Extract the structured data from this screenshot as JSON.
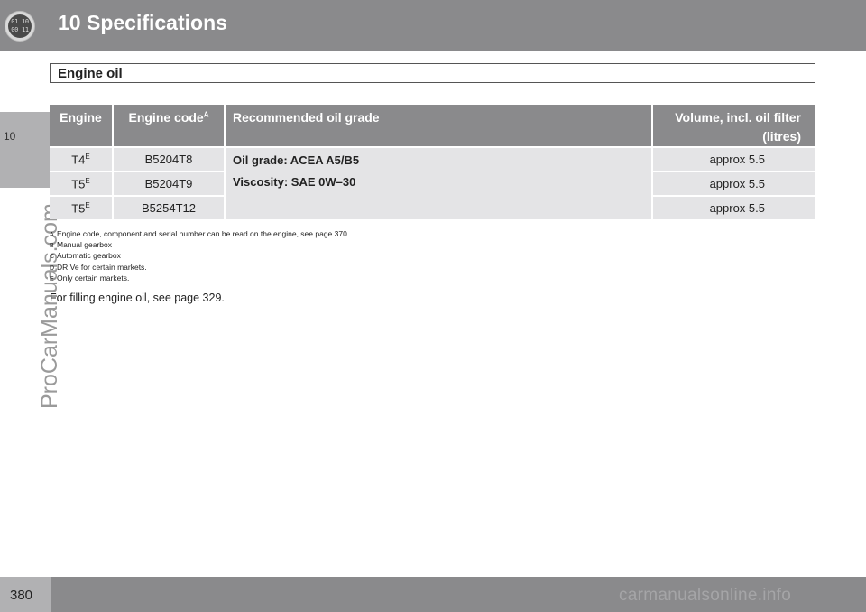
{
  "header": {
    "chapter_icon_text": "01 10\n00 11",
    "chapter_title": "10 Specifications"
  },
  "side_tab": {
    "number": "10",
    "watermark": "ProCarManuals.com"
  },
  "section": {
    "title": "Engine oil"
  },
  "table": {
    "headers": {
      "engine": "Engine",
      "engine_code": "Engine code",
      "engine_code_sup": "A",
      "grade": "Recommended oil grade",
      "volume_line1": "Volume, incl. oil filter",
      "volume_line2": "(litres)"
    },
    "grade_text": {
      "oil_grade": "Oil grade: ACEA A5/B5",
      "viscosity": "Viscosity: SAE 0W–30"
    },
    "rows": [
      {
        "engine": "T4",
        "engine_sup": "E",
        "code": "B5204T8",
        "volume": "approx 5.5"
      },
      {
        "engine": "T5",
        "engine_sup": "E",
        "code": "B5204T9",
        "volume": "approx 5.5"
      },
      {
        "engine": "T5",
        "engine_sup": "E",
        "code": "B5254T12",
        "volume": "approx 5.5"
      }
    ]
  },
  "footnotes": [
    {
      "mark": "A",
      "text": "Engine code, component and serial number can be read on the engine, see page 370."
    },
    {
      "mark": "B",
      "text": "Manual gearbox"
    },
    {
      "mark": "C",
      "text": "Automatic gearbox"
    },
    {
      "mark": "D",
      "text": "DRIVe for certain markets."
    },
    {
      "mark": "E",
      "text": "Only certain markets."
    }
  ],
  "filling_note": "For filling engine oil, see page 329.",
  "footer": {
    "page_number": "380",
    "watermark": "carmanualsonline.info"
  }
}
